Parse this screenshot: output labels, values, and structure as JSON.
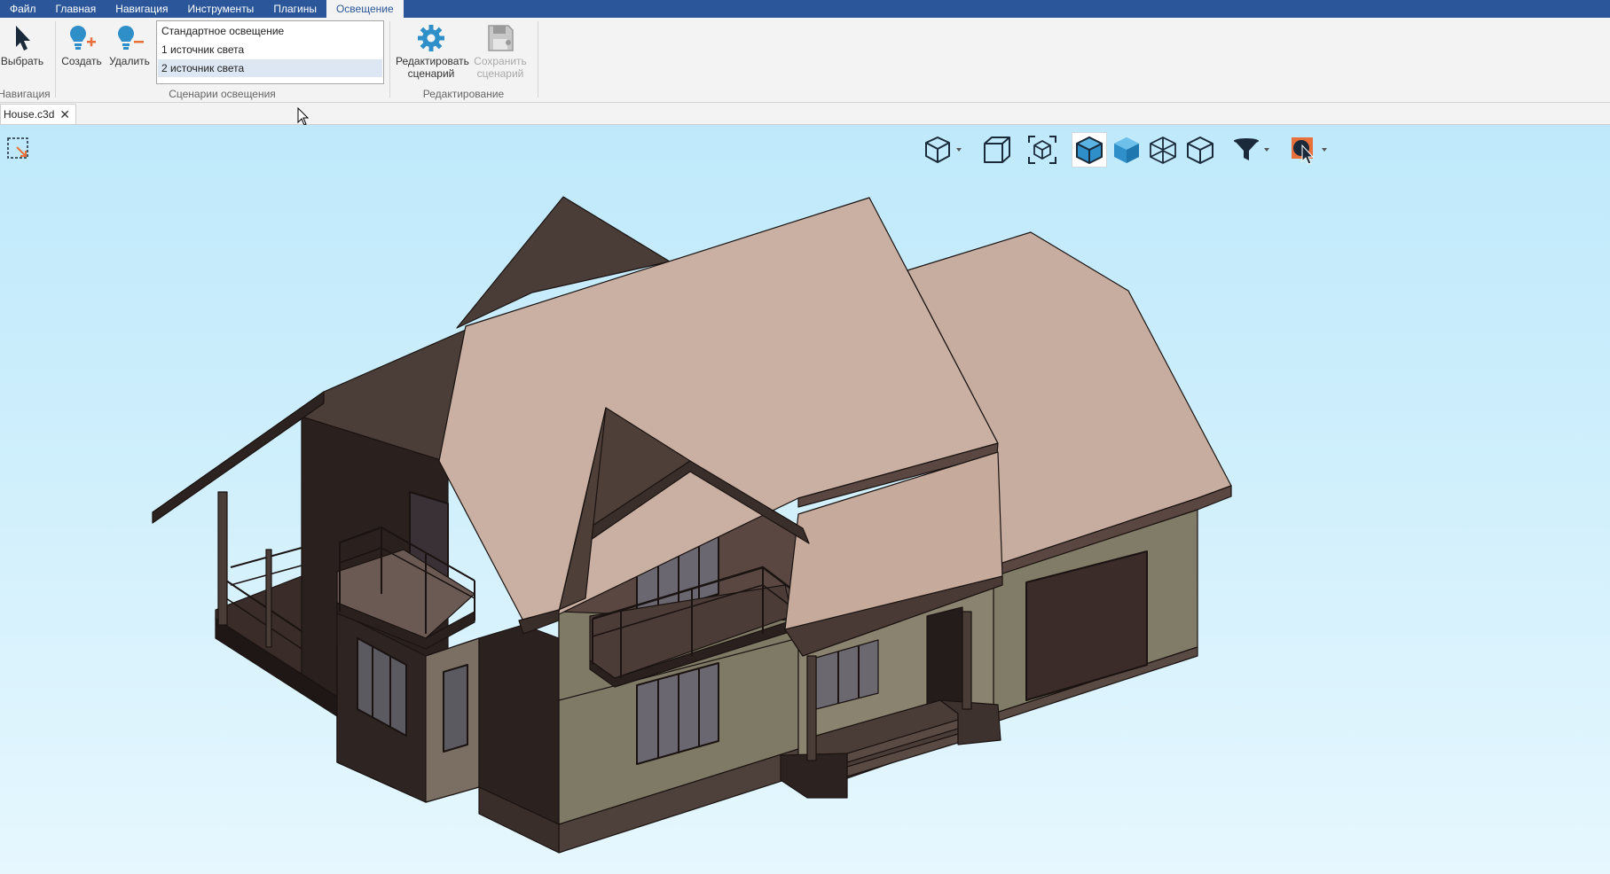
{
  "menu": {
    "items": [
      "Файл",
      "Главная",
      "Навигация",
      "Инструменты",
      "Плагины",
      "Освещение"
    ],
    "active": "Освещение"
  },
  "ribbon": {
    "navigation": {
      "select_label": "Выбрать",
      "group_label": "Навигация"
    },
    "scenarios": {
      "create_label": "Создать",
      "delete_label": "Удалить",
      "list": [
        "Стандартное освещение",
        "1 источник света",
        "2 источник света"
      ],
      "selected": "2 источник света",
      "group_label": "Сценарии освещения"
    },
    "editing": {
      "edit_label_1": "Редактировать",
      "edit_label_2": "сценарий",
      "save_label_1": "Сохранить",
      "save_label_2": "сценарий",
      "group_label": "Редактирование"
    }
  },
  "document": {
    "tab_title": "House.c3d"
  },
  "viewport": {
    "tools": [
      "view-orientation-icon",
      "box-view-icon",
      "zoom-fit-icon",
      "shaded-edges-icon",
      "shaded-icon",
      "wireframe-icon",
      "hidden-lines-icon",
      "filter-icon",
      "selection-mode-icon"
    ],
    "active_tool": "shaded-edges-icon"
  },
  "colors": {
    "menubar": "#2b579a",
    "accent_icon": "#2e8fc9",
    "roof": "#c9b0a3",
    "wall": "#7f7a66",
    "dark_wall": "#2a211e"
  }
}
